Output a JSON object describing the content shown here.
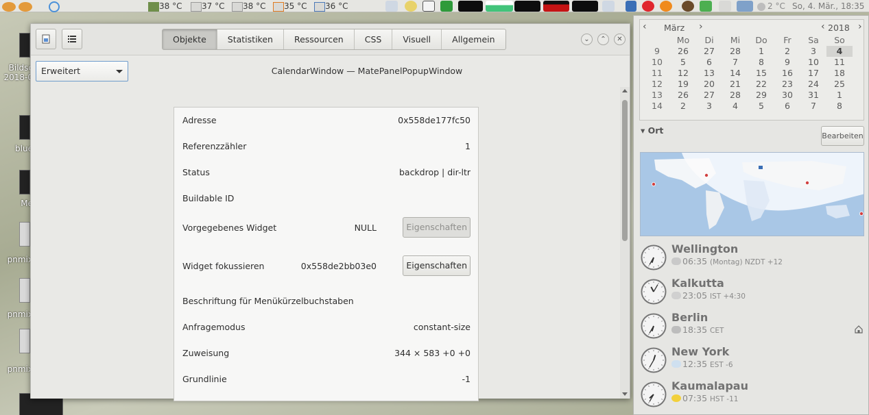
{
  "panel": {
    "temps": [
      "38 °C",
      "37 °C",
      "38 °C",
      "35 °C",
      "36 °C"
    ],
    "weather": "2 °C",
    "clock": "So,  4. Mär., 18:35"
  },
  "desktop": {
    "icons": [
      "Bildsc",
      "2018-0",
      "blue",
      "Me",
      "pnmix",
      "pnmix",
      "pnmix"
    ]
  },
  "inspector": {
    "tabs": [
      "Objekte",
      "Statistiken",
      "Ressourcen",
      "CSS",
      "Visuell",
      "Allgemein"
    ],
    "active_tab": "Objekte",
    "mode": "Erweitert",
    "object_title": "CalendarWindow — MatePanelPopupWindow",
    "properties": [
      {
        "label": "Adresse",
        "value": "0x558de177fc50"
      },
      {
        "label": "Referenzzähler",
        "value": "1"
      },
      {
        "label": "Status",
        "value": "backdrop | dir-ltr"
      },
      {
        "label": "Buildable ID",
        "value": ""
      },
      {
        "label": "Vorgegebenes Widget",
        "value": "NULL",
        "button": "Eigenschaften",
        "button_enabled": false
      },
      {
        "label": "Widget fokussieren",
        "value": "0x558de2bb03e0",
        "button": "Eigenschaften",
        "button_enabled": true
      },
      {
        "label": "Beschriftung für Menükürzelbuchstaben",
        "value": ""
      },
      {
        "label": "Anfragemodus",
        "value": "constant-size"
      },
      {
        "label": "Zuweisung",
        "value": "344 × 583 +0 +0"
      },
      {
        "label": "Grundlinie",
        "value": "-1"
      }
    ]
  },
  "calendar": {
    "month": "März",
    "year": "2018",
    "weekdays": [
      "Mo",
      "Di",
      "Mi",
      "Do",
      "Fr",
      "Sa",
      "So"
    ],
    "weeks": [
      {
        "wk": "9",
        "days": [
          "26",
          "27",
          "28",
          "1",
          "2",
          "3",
          "4"
        ]
      },
      {
        "wk": "10",
        "days": [
          "5",
          "6",
          "7",
          "8",
          "9",
          "10",
          "11"
        ]
      },
      {
        "wk": "11",
        "days": [
          "12",
          "13",
          "14",
          "15",
          "16",
          "17",
          "18"
        ]
      },
      {
        "wk": "12",
        "days": [
          "19",
          "20",
          "21",
          "22",
          "23",
          "24",
          "25"
        ]
      },
      {
        "wk": "13",
        "days": [
          "26",
          "27",
          "28",
          "29",
          "30",
          "31",
          "1"
        ]
      },
      {
        "wk": "14",
        "days": [
          "2",
          "3",
          "4",
          "5",
          "6",
          "7",
          "8"
        ]
      }
    ],
    "today": "4",
    "locations_label": "Ort",
    "edit_label": "Bearbeiten",
    "locations": [
      {
        "city": "Wellington",
        "time": "06:35",
        "extra": "(Montag) NZDT +12",
        "weather_icon": "partly-cloudy-night-icon",
        "hour": 6,
        "minute": 35
      },
      {
        "city": "Kalkutta",
        "time": "23:05",
        "extra": "IST +4:30",
        "weather_icon": "fog-icon",
        "hour": 23,
        "minute": 5
      },
      {
        "city": "Berlin",
        "time": "18:35",
        "extra": "CET",
        "weather_icon": "overcast-icon",
        "hour": 18,
        "minute": 35,
        "home": true
      },
      {
        "city": "New York",
        "time": "12:35",
        "extra": "EST -6",
        "weather_icon": "cloud-icon",
        "hour": 12,
        "minute": 35
      },
      {
        "city": "Kaumalapau",
        "time": "07:35",
        "extra": "HST -11",
        "weather_icon": "sun-icon",
        "hour": 7,
        "minute": 35
      }
    ]
  }
}
